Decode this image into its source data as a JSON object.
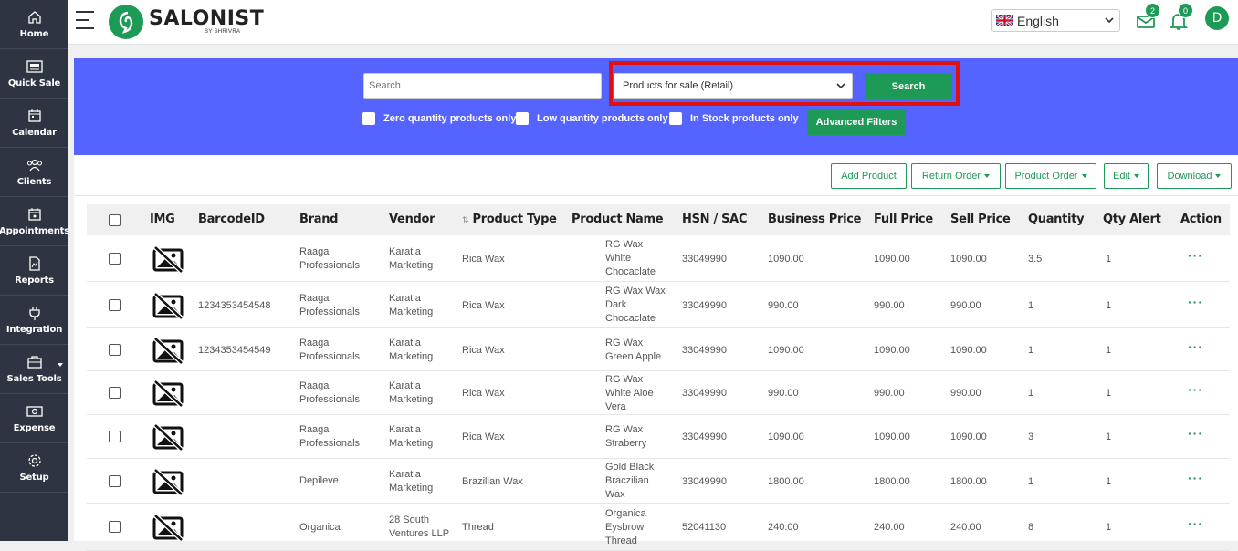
{
  "sidebar": {
    "items": [
      {
        "label": "Home",
        "icon": "home-icon"
      },
      {
        "label": "Quick Sale",
        "icon": "register-icon"
      },
      {
        "label": "Calendar",
        "icon": "calendar-icon"
      },
      {
        "label": "Clients",
        "icon": "users-icon"
      },
      {
        "label": "Appointments",
        "icon": "appointment-icon"
      },
      {
        "label": "Reports",
        "icon": "report-icon"
      },
      {
        "label": "Integration",
        "icon": "plug-icon"
      },
      {
        "label": "Sales Tools",
        "icon": "briefcase-icon"
      },
      {
        "label": "Expense",
        "icon": "money-icon"
      },
      {
        "label": "Setup",
        "icon": "gear-icon"
      }
    ]
  },
  "header": {
    "logo_text": "SALONIST",
    "logo_sub": "BY SHRIVRA",
    "language": "English",
    "messages_count": "2",
    "notifications_count": "0",
    "avatar_initial": "D"
  },
  "search": {
    "placeholder": "Search",
    "product_filter": "Products for sale (Retail)",
    "search_button": "Search",
    "checkboxes": [
      "Zero quantity products only",
      "Low quantity products only",
      "In Stock products only"
    ],
    "advanced_filters": "Advanced Filters"
  },
  "toolbar": {
    "add_product": "Add Product",
    "return_order": "Return Order",
    "product_order": "Product Order",
    "edit": "Edit",
    "download": "Download"
  },
  "table": {
    "headers": {
      "img": "IMG",
      "barcode": "BarcodeID",
      "brand": "Brand",
      "vendor": "Vendor",
      "type": "Product Type",
      "name": "Product Name",
      "hsn": "HSN / SAC",
      "business": "Business Price",
      "full": "Full Price",
      "sell": "Sell Price",
      "qty": "Quantity",
      "alert": "Qty Alert",
      "action": "Action"
    },
    "sort_icon": "⇅",
    "action_icon": "···",
    "rows": [
      {
        "barcode": "",
        "brand": [
          "Raaga",
          "Professionals"
        ],
        "vendor": [
          "Karatia",
          "Marketing"
        ],
        "type": "Rica Wax",
        "name": [
          "RG Wax",
          "White",
          "Chocaclate"
        ],
        "hsn": "33049990",
        "business": "1090.00",
        "full": "1090.00",
        "sell": "1090.00",
        "qty": "3.5",
        "alert": "1"
      },
      {
        "barcode": "1234353454548",
        "brand": [
          "Raaga",
          "Professionals"
        ],
        "vendor": [
          "Karatia",
          "Marketing"
        ],
        "type": "Rica Wax",
        "name": [
          "RG Wax Wax",
          "Dark",
          "Chocaclate"
        ],
        "hsn": "33049990",
        "business": "990.00",
        "full": "990.00",
        "sell": "990.00",
        "qty": "1",
        "alert": "1"
      },
      {
        "barcode": "1234353454549",
        "brand": [
          "Raaga",
          "Professionals"
        ],
        "vendor": [
          "Karatia",
          "Marketing"
        ],
        "type": "Rica Wax",
        "name": [
          "RG Wax",
          "Green Apple"
        ],
        "hsn": "33049990",
        "business": "1090.00",
        "full": "1090.00",
        "sell": "1090.00",
        "qty": "1",
        "alert": "1"
      },
      {
        "barcode": "",
        "brand": [
          "Raaga",
          "Professionals"
        ],
        "vendor": [
          "Karatia",
          "Marketing"
        ],
        "type": "Rica Wax",
        "name": [
          "RG Wax",
          "White Aloe",
          "Vera"
        ],
        "hsn": "33049990",
        "business": "990.00",
        "full": "990.00",
        "sell": "990.00",
        "qty": "1",
        "alert": "1"
      },
      {
        "barcode": "",
        "brand": [
          "Raaga",
          "Professionals"
        ],
        "vendor": [
          "Karatia",
          "Marketing"
        ],
        "type": "Rica Wax",
        "name": [
          "RG Wax",
          "Straberry"
        ],
        "hsn": "33049990",
        "business": "1090.00",
        "full": "1090.00",
        "sell": "1090.00",
        "qty": "3",
        "alert": "1"
      },
      {
        "barcode": "",
        "brand": [
          "Depileve"
        ],
        "vendor": [
          "Karatia",
          "Marketing"
        ],
        "type": "Brazilian Wax",
        "name": [
          "Gold Black",
          "Braczilian",
          "Wax"
        ],
        "hsn": "33049990",
        "business": "1800.00",
        "full": "1800.00",
        "sell": "1800.00",
        "qty": "1",
        "alert": "1"
      },
      {
        "barcode": "",
        "brand": [
          "Organica"
        ],
        "vendor": [
          "28 South",
          "Ventures LLP"
        ],
        "type": "Thread",
        "name": [
          "Organica",
          "Eysbrow",
          "Thread"
        ],
        "hsn": "52041130",
        "business": "240.00",
        "full": "240.00",
        "sell": "240.00",
        "qty": "8",
        "alert": "1"
      }
    ]
  },
  "colors": {
    "accent": "#1e9a57",
    "band": "#5664ff",
    "highlight": "#e01010",
    "sidebar": "#2e3441"
  }
}
